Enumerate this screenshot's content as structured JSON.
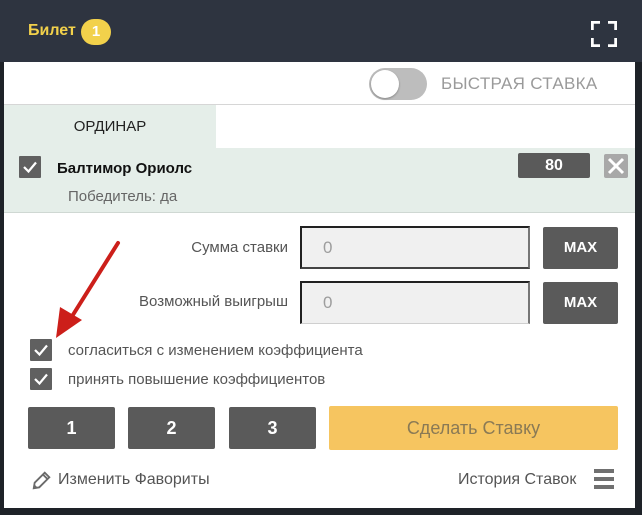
{
  "header": {
    "title": "Билет",
    "badge_count": "1"
  },
  "quick_bet": {
    "label": "БЫСТРАЯ СТАВКА",
    "enabled": false
  },
  "tabs": [
    {
      "label": "ОРДИНАР",
      "active": true
    }
  ],
  "bet": {
    "team": "Балтимор Ориолс",
    "market": "Победитель: да",
    "odds": "80",
    "selected": true
  },
  "stake": {
    "label": "Сумма ставки",
    "value": "0",
    "max_label": "MAX"
  },
  "payout": {
    "label": "Возможный выигрыш",
    "value": "0",
    "max_label": "MAX"
  },
  "options": [
    {
      "label": "согласиться с изменением коэффициента",
      "checked": true
    },
    {
      "label": "принять повышение коэффициентов",
      "checked": true
    }
  ],
  "presets": [
    "1",
    "2",
    "3"
  ],
  "place_bet_label": "Сделать Ставку",
  "footer": {
    "edit_favorites": "Изменить Фавориты",
    "bet_history": "История Ставок"
  },
  "colors": {
    "header_bg": "#2e3440",
    "accent_yellow": "#f2d14b",
    "selection_bg": "#e5eee9",
    "button_dark": "#5a5a5a",
    "place_bet_bg": "#f6c560",
    "annotation_arrow": "#cc1f1a"
  },
  "icons": {
    "expand": "expand-icon",
    "check": "check-icon",
    "close": "close-icon",
    "pencil": "pencil-icon",
    "history": "menu-icon",
    "annotation": "arrow-icon"
  }
}
